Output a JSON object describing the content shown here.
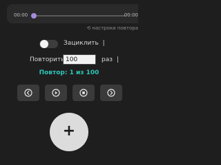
{
  "player": {
    "time_start": "00:00",
    "time_end": "00:00",
    "progress": 0
  },
  "settings_link": {
    "icon": "repeat-icon",
    "label": "настроки повтора"
  },
  "loop": {
    "label": "Зациклить",
    "separator": "|",
    "enabled": false
  },
  "repeat": {
    "label": "Повторить:",
    "value": "100",
    "unit": "раз",
    "separator": "|"
  },
  "status": {
    "text": "Повтор: 1 из 100",
    "color": "#2ec4b6"
  },
  "controls": {
    "icons": [
      "rewind-icon",
      "play-icon",
      "stop-icon",
      "forward-icon"
    ]
  },
  "fab": {
    "icon": "plus-icon",
    "symbol": "+"
  },
  "colors": {
    "background": "#1e1e1e",
    "accent": "#a48bdc",
    "status": "#2ec4b6"
  }
}
